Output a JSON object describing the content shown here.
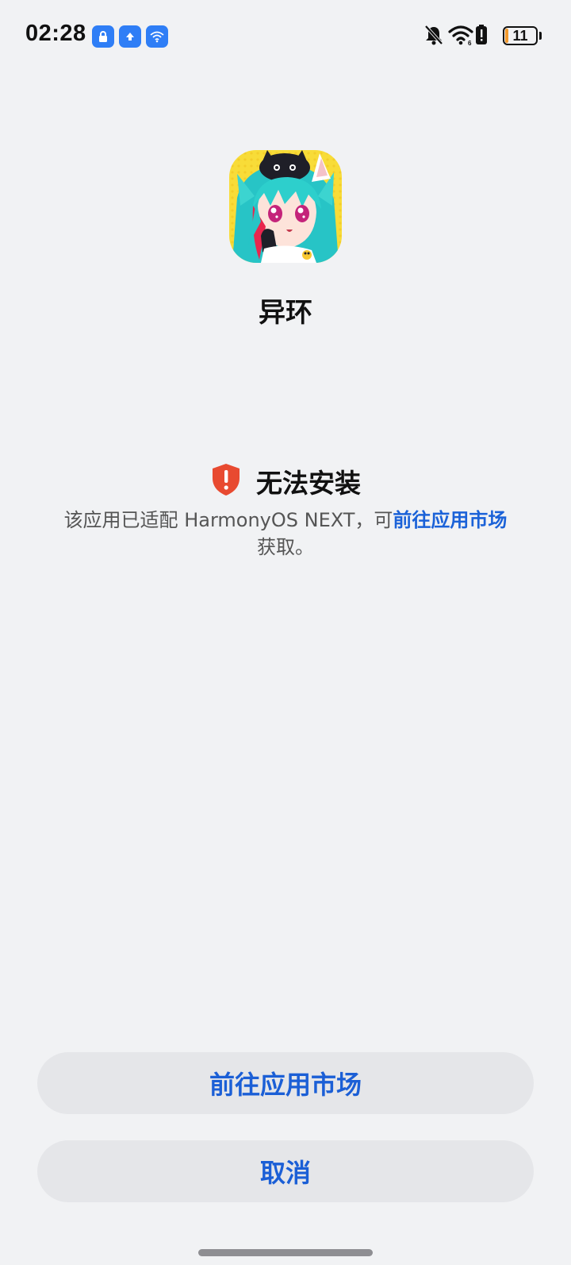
{
  "status_bar": {
    "time": "02:28",
    "battery_level": "11",
    "battery_fraction": 0.11,
    "notification_icons": [
      "lock-app-icon",
      "upload-app-icon",
      "wifi-app-icon"
    ],
    "system_icons": [
      "bell-muted-icon",
      "wifi-signal-icon",
      "battery-alert-icon",
      "battery-icon"
    ]
  },
  "app": {
    "name": "异环",
    "icon": "app-icon-anime-character"
  },
  "error": {
    "icon": "shield-alert-icon",
    "title": "无法安装",
    "desc_prefix": "该应用已适配 HarmonyOS NEXT，可",
    "desc_link": "前往应用市场",
    "desc_suffix": "获取。"
  },
  "buttons": {
    "market_label": "前往应用市场",
    "cancel_label": "取消"
  },
  "colors": {
    "background": "#f1f2f4",
    "accent": "#1b5fd6",
    "error_shield": "#e84a30",
    "button_bg": "#e5e6e9"
  }
}
